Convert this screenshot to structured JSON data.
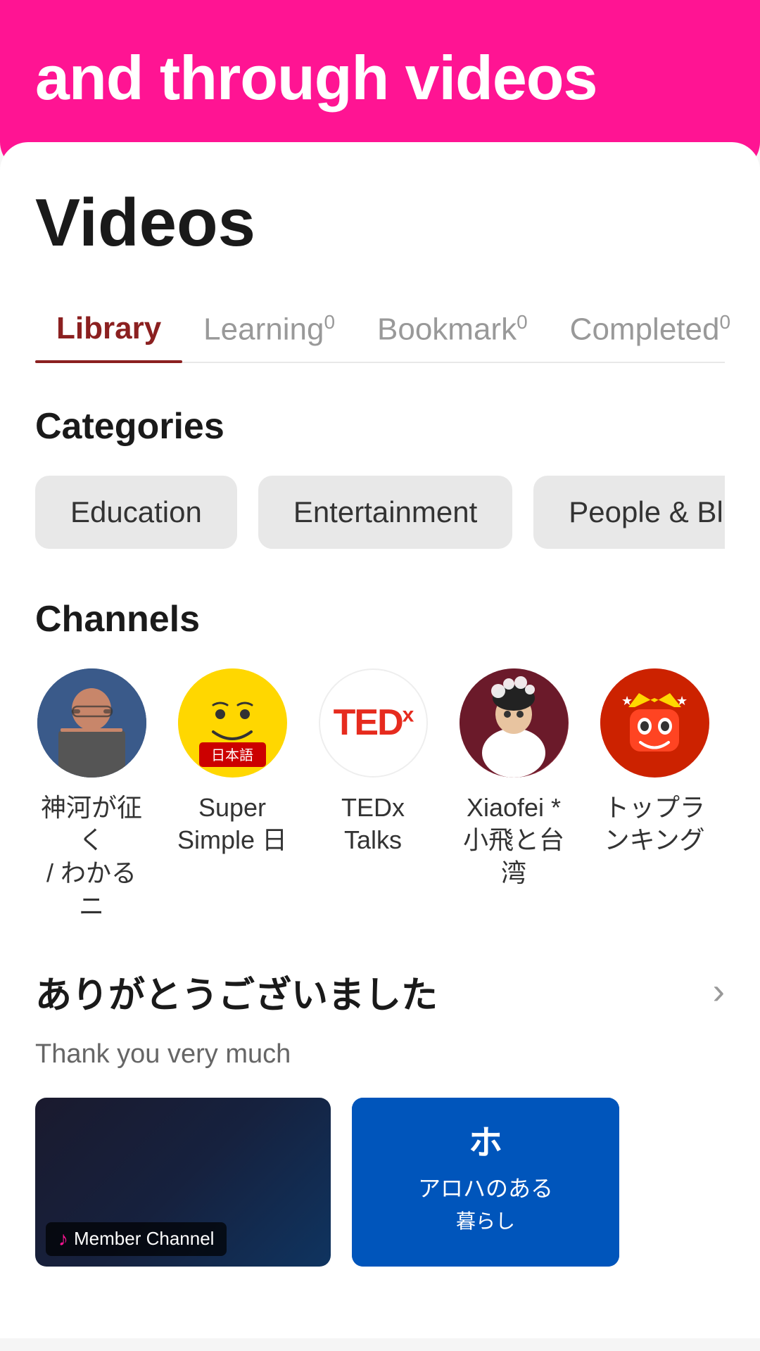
{
  "header": {
    "banner_text": "and through videos",
    "banner_bg": "#FF1493"
  },
  "page": {
    "title": "Videos"
  },
  "tabs": [
    {
      "id": "library",
      "label": "Library",
      "count": null,
      "active": true
    },
    {
      "id": "learning",
      "label": "Learning",
      "count": "0",
      "active": false
    },
    {
      "id": "bookmark",
      "label": "Bookmark",
      "count": "0",
      "active": false
    },
    {
      "id": "completed",
      "label": "Completed",
      "count": "0",
      "active": false
    }
  ],
  "categories": {
    "section_title": "Categories",
    "items": [
      {
        "id": "education",
        "label": "Education"
      },
      {
        "id": "entertainment",
        "label": "Entertainment"
      },
      {
        "id": "people_blogs",
        "label": "People & Bl..."
      }
    ]
  },
  "channels": {
    "section_title": "Channels",
    "items": [
      {
        "id": "ch1",
        "name": "神河が征く\n/ わかるニ",
        "type": "person1"
      },
      {
        "id": "ch2",
        "name": "Super\nSimple 日",
        "type": "emoji"
      },
      {
        "id": "ch3",
        "name": "TEDx\nTalks",
        "type": "tedx"
      },
      {
        "id": "ch4",
        "name": "Xiaofei *\n小飛と台湾",
        "type": "person3"
      },
      {
        "id": "ch5",
        "name": "トップラ\nンキング",
        "type": "person4"
      }
    ]
  },
  "featured_section": {
    "japanese_title": "ありがとうございました",
    "english_subtitle": "Thank you very much",
    "chevron": "›"
  },
  "video_previews": [
    {
      "id": "v1",
      "badge_label": "Member Channel",
      "thumb_type": "dark"
    },
    {
      "id": "v2",
      "thumb_type": "blue"
    }
  ]
}
